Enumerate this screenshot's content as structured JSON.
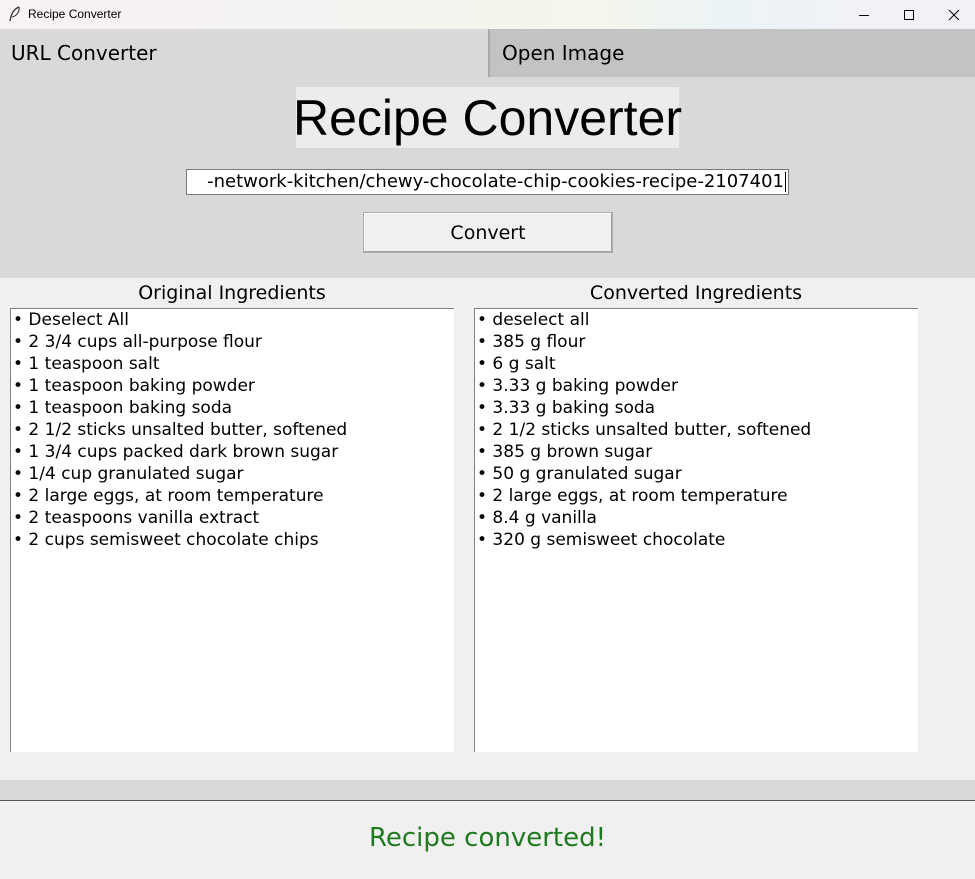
{
  "window": {
    "title": "Recipe Converter"
  },
  "tabs": [
    {
      "label": "URL Converter"
    },
    {
      "label": "Open Image"
    }
  ],
  "header": {
    "title": "Recipe Converter",
    "url_value": "-network-kitchen/chewy-chocolate-chip-cookies-recipe-2107401",
    "convert_label": "Convert"
  },
  "original": {
    "label": "Original Ingredients",
    "items": [
      "• Deselect All",
      "• 2 3/4 cups all-purpose flour",
      "• 1 teaspoon salt",
      "• 1 teaspoon baking powder",
      "• 1 teaspoon baking soda",
      "• 2 1/2 sticks unsalted butter, softened",
      "• 1 3/4 cups packed dark brown sugar",
      "• 1/4 cup granulated sugar",
      "• 2 large eggs, at room temperature",
      "• 2 teaspoons vanilla extract",
      "• 2 cups semisweet chocolate chips"
    ]
  },
  "converted": {
    "label": "Converted Ingredients",
    "items": [
      "• deselect all",
      "• 385 g flour",
      "• 6 g salt",
      "• 3.33 g baking powder",
      "• 3.33 g baking soda",
      "• 2 1/2 sticks unsalted butter, softened",
      "• 385 g brown sugar",
      "• 50 g granulated sugar",
      "• 2 large eggs, at room temperature",
      "• 8.4 g vanilla",
      "• 320 g semisweet chocolate"
    ]
  },
  "status": {
    "message": "Recipe converted!",
    "color": "#1f7a1f"
  }
}
